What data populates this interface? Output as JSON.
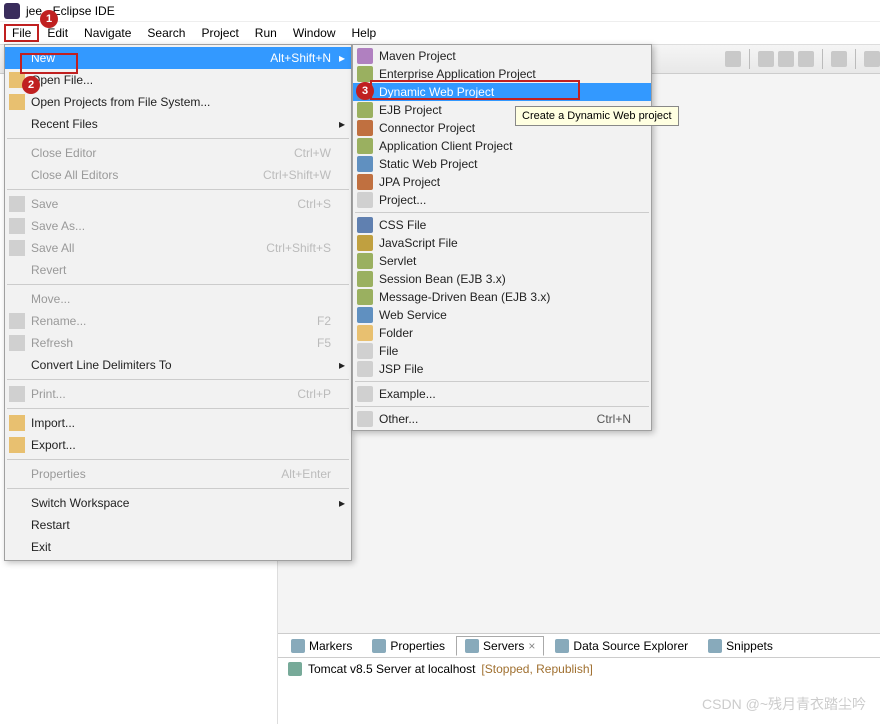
{
  "titlebar": {
    "title": "jee - Eclipse IDE"
  },
  "menubar": [
    "File",
    "Edit",
    "Navigate",
    "Search",
    "Project",
    "Run",
    "Window",
    "Help"
  ],
  "fileMenu": [
    {
      "label": "New",
      "kb": "Alt+Shift+N",
      "arrow": true,
      "highlight": true,
      "icon": ""
    },
    {
      "label": "Open File...",
      "icon": "folder"
    },
    {
      "label": "Open Projects from File System...",
      "icon": "folder"
    },
    {
      "label": "Recent Files",
      "arrow": true
    },
    {
      "sep": true
    },
    {
      "label": "Close Editor",
      "kb": "Ctrl+W",
      "disabled": true
    },
    {
      "label": "Close All Editors",
      "kb": "Ctrl+Shift+W",
      "disabled": true
    },
    {
      "sep": true
    },
    {
      "label": "Save",
      "kb": "Ctrl+S",
      "disabled": true,
      "icon": "file"
    },
    {
      "label": "Save As...",
      "disabled": true,
      "icon": "file"
    },
    {
      "label": "Save All",
      "kb": "Ctrl+Shift+S",
      "disabled": true,
      "icon": "file"
    },
    {
      "label": "Revert",
      "disabled": true
    },
    {
      "sep": true
    },
    {
      "label": "Move...",
      "disabled": true
    },
    {
      "label": "Rename...",
      "kb": "F2",
      "disabled": true,
      "icon": "file"
    },
    {
      "label": "Refresh",
      "kb": "F5",
      "disabled": true,
      "icon": "file"
    },
    {
      "label": "Convert Line Delimiters To",
      "arrow": true
    },
    {
      "sep": true
    },
    {
      "label": "Print...",
      "kb": "Ctrl+P",
      "disabled": true,
      "icon": "file"
    },
    {
      "sep": true
    },
    {
      "label": "Import...",
      "icon": "folder"
    },
    {
      "label": "Export...",
      "icon": "folder"
    },
    {
      "sep": true
    },
    {
      "label": "Properties",
      "kb": "Alt+Enter",
      "disabled": true
    },
    {
      "sep": true
    },
    {
      "label": "Switch Workspace",
      "arrow": true
    },
    {
      "label": "Restart"
    },
    {
      "label": "Exit"
    }
  ],
  "newMenu": [
    {
      "label": "Maven Project",
      "icon": "wiz"
    },
    {
      "label": "Enterprise Application Project",
      "icon": "bean"
    },
    {
      "label": "Dynamic Web Project",
      "highlight": true,
      "icon": "globe"
    },
    {
      "label": "EJB Project",
      "icon": "bean"
    },
    {
      "label": "Connector Project",
      "icon": "db"
    },
    {
      "label": "Application Client Project",
      "icon": "bean"
    },
    {
      "label": "Static Web Project",
      "icon": "globe"
    },
    {
      "label": "JPA Project",
      "icon": "db"
    },
    {
      "label": "Project...",
      "icon": "file"
    },
    {
      "sep": true
    },
    {
      "label": "CSS File",
      "icon": "css"
    },
    {
      "label": "JavaScript File",
      "icon": "js"
    },
    {
      "label": "Servlet",
      "icon": "bean"
    },
    {
      "label": "Session Bean (EJB 3.x)",
      "icon": "bean"
    },
    {
      "label": "Message-Driven Bean (EJB 3.x)",
      "icon": "bean"
    },
    {
      "label": "Web Service",
      "icon": "globe"
    },
    {
      "label": "Folder",
      "icon": "folder"
    },
    {
      "label": "File",
      "icon": "file"
    },
    {
      "label": "JSP File",
      "icon": "file"
    },
    {
      "sep": true
    },
    {
      "label": "Example...",
      "icon": "file"
    },
    {
      "sep": true
    },
    {
      "label": "Other...",
      "kb": "Ctrl+N",
      "icon": "file"
    }
  ],
  "tooltip": "Create a Dynamic Web project",
  "badges": [
    "1",
    "2",
    "3"
  ],
  "bottomTabs": [
    {
      "label": "Markers"
    },
    {
      "label": "Properties"
    },
    {
      "label": "Servers",
      "active": true,
      "close": true
    },
    {
      "label": "Data Source Explorer"
    },
    {
      "label": "Snippets"
    }
  ],
  "serverLine": {
    "name": "Tomcat v8.5 Server at localhost",
    "status": "[Stopped, Republish]"
  },
  "watermark": "CSDN @~残月青衣踏尘吟"
}
